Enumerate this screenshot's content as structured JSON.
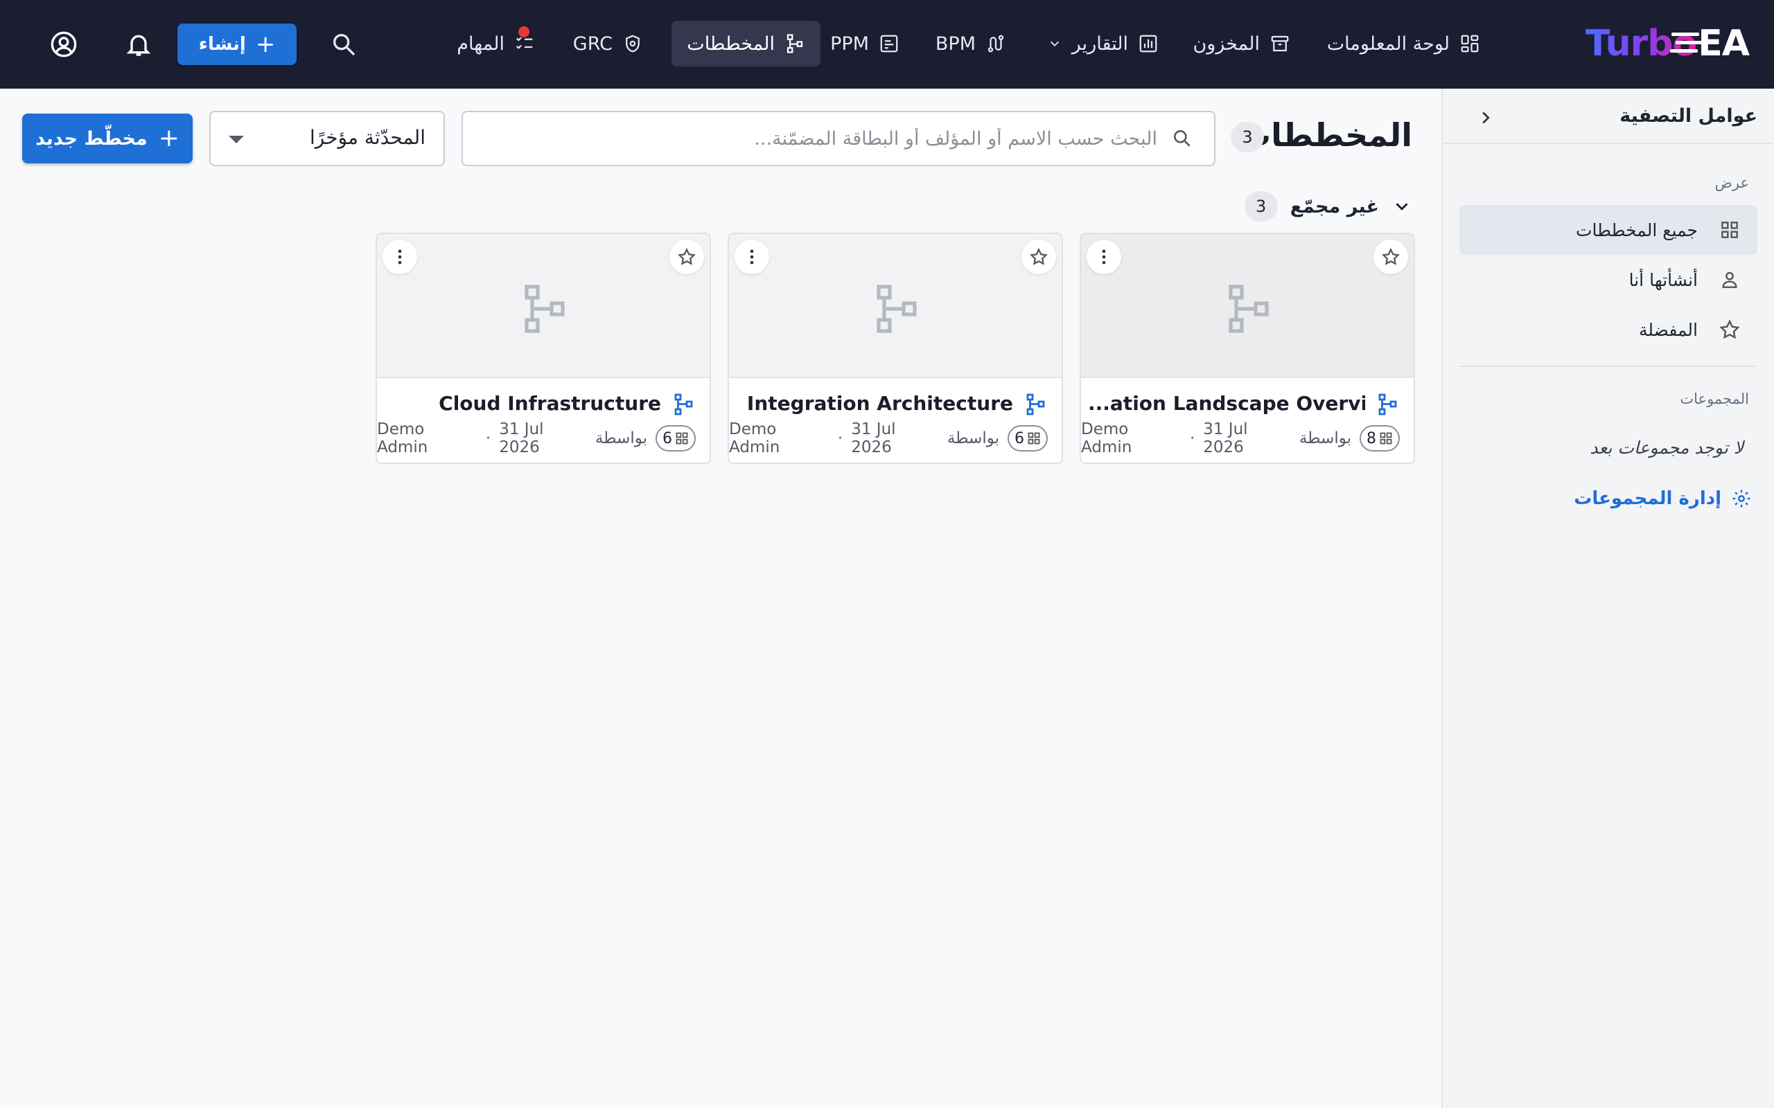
{
  "brand": {
    "name_part1": "Turbo",
    "name_part2": "EA"
  },
  "nav": {
    "dashboard": "لوحة المعلومات",
    "inventory": "المخزون",
    "reports": "التقارير",
    "bpm": "BPM",
    "ppm": "PPM",
    "diagrams": "المخططات",
    "grc": "GRC",
    "tasks": "المهام",
    "create_label": "إنشاء"
  },
  "sidebar": {
    "title": "عوامل التصفية",
    "view_section": "عرض",
    "views": [
      {
        "label": "جميع المخططات",
        "icon": "grid-icon"
      },
      {
        "label": "أنشأتها أنا",
        "icon": "person-icon"
      },
      {
        "label": "المفضلة",
        "icon": "star-icon"
      }
    ],
    "groups_section": "المجموعات",
    "groups_empty": "لا توجد مجموعات بعد",
    "manage_groups": "إدارة المجموعات"
  },
  "main": {
    "title": "المخططات",
    "total_count": "3",
    "search_placeholder": "البحث حسب الاسم أو المؤلف أو البطاقة المضمّنة...",
    "sort_value": "المحدّثة مؤخرًا",
    "new_button": "مخطّط جديد",
    "group": {
      "label": "غير مجمّع",
      "count": "3"
    }
  },
  "cards": [
    {
      "name": "...ation Landscape Overview",
      "by_label": "بواسطة",
      "author": "Demo Admin",
      "date": "31 Jul 2026",
      "card_count": "8"
    },
    {
      "name": "Integration Architecture",
      "by_label": "بواسطة",
      "author": "Demo Admin",
      "date": "31 Jul 2026",
      "card_count": "6"
    },
    {
      "name": "Cloud Infrastructure",
      "by_label": "بواسطة",
      "author": "Demo Admin",
      "date": "31 Jul 2026",
      "card_count": "6"
    }
  ],
  "colors": {
    "topbar": "#1b1d31",
    "accent": "#1e6fd6",
    "notification_dot": "#e53935"
  }
}
